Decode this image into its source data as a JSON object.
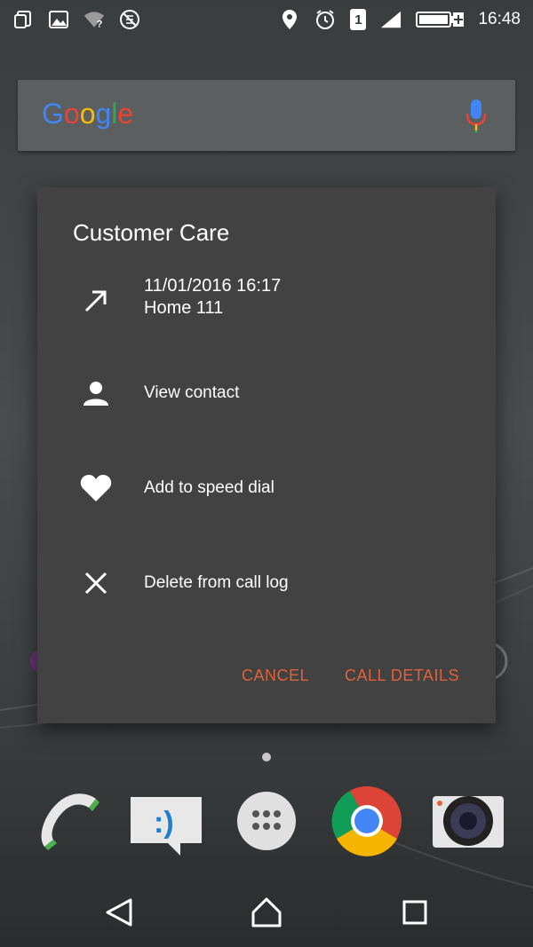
{
  "status_bar": {
    "time": "16:48",
    "sim_slot": "1",
    "icons_left": [
      "copy-icon",
      "image-icon",
      "wifi-unknown-icon",
      "no-data-icon"
    ],
    "icons_right": [
      "location-icon",
      "alarm-icon",
      "sim-icon",
      "signal-icon",
      "battery-charging-icon"
    ]
  },
  "search": {
    "logo_letters": [
      {
        "ch": "G",
        "color": "#4285F4"
      },
      {
        "ch": "o",
        "color": "#EA4335"
      },
      {
        "ch": "o",
        "color": "#FBBC05"
      },
      {
        "ch": "g",
        "color": "#4285F4"
      },
      {
        "ch": "l",
        "color": "#34A853"
      },
      {
        "ch": "e",
        "color": "#EA4335"
      }
    ],
    "mic_icon": "mic-icon"
  },
  "dialog": {
    "title": "Customer Care",
    "call_entry": {
      "datetime": "11/01/2016 16:17",
      "number": "Home 111",
      "icon": "outgoing-call-icon"
    },
    "items": [
      {
        "label": "View contact",
        "icon": "person-icon"
      },
      {
        "label": "Add to speed dial",
        "icon": "heart-icon"
      },
      {
        "label": "Delete from call log",
        "icon": "close-icon"
      }
    ],
    "buttons": {
      "cancel": "CANCEL",
      "call_details": "CALL DETAILS"
    },
    "accent_color": "#E0613A"
  },
  "dock": {
    "apps": [
      "phone-icon",
      "messaging-icon",
      "app-drawer-icon",
      "chrome-icon",
      "camera-icon"
    ]
  },
  "nav": {
    "buttons": [
      "back-icon",
      "home-icon",
      "recents-icon"
    ]
  }
}
